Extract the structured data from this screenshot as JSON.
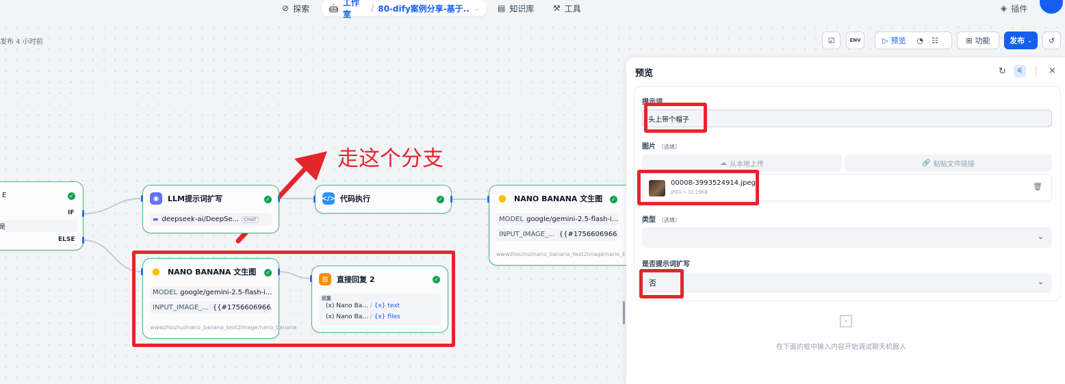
{
  "nav": {
    "explore": "探索",
    "studio": "工作室",
    "app_name": "80-dify案例分享-基于...",
    "knowledge": "知识库",
    "tools": "工具",
    "plugins": "插件"
  },
  "toolbar": {
    "publish_time": "发布 4 小时前",
    "preview": "预览",
    "features": "功能",
    "publish": "发布"
  },
  "annotation": {
    "text": "走这个分支"
  },
  "nodes": {
    "if_node": {
      "if_label": "IF",
      "else_label": "ELSE",
      "row_partial": "是",
      "title_partial": "E"
    },
    "llm": {
      "title": "LLM提示词扩写",
      "model": "deepseek-ai/DeepSe...",
      "mode": "CHAT"
    },
    "code": {
      "title": "代码执行"
    },
    "nano_top": {
      "title": "NANO BANANA 文生图",
      "model_label": "MODEL",
      "model_value": "google/gemini-2.5-flash-i...",
      "input_label": "INPUT_IMAGE_...",
      "input_value": "{{#1756606966...",
      "source": "wwwzhouhui/nano_banana_text2image/nano_b"
    },
    "nano_bottom": {
      "title": "NANO BANANA 文生图",
      "model_label": "MODEL",
      "model_value": "google/gemini-2.5-flash-i...",
      "input_label": "INPUT_IMAGE_...",
      "input_value": "{{#1756606966...",
      "source": "wwwzhouhui/nano_banana_text2image/nano_banana"
    },
    "reply": {
      "title": "直接回复 2",
      "section": "回复",
      "rows": [
        {
          "var": "Nano Ba...",
          "field": "text"
        },
        {
          "var": "Nano Ba...",
          "field": "files"
        }
      ]
    }
  },
  "preview": {
    "title": "预览",
    "prompt_label": "提示词",
    "prompt_value": "头上带个帽子",
    "image_label": "图片",
    "optional": "（选填）",
    "upload_local": "从本地上传",
    "paste_link": "粘贴文件链接",
    "file_name": "00008-3993524914.jpeg",
    "file_meta": "JPEG • 32.19KB",
    "type_label": "类型",
    "expand_label": "是否提示词扩写",
    "expand_value": "否",
    "empty_hint": "在下面的框中输入内容开始调试聊天机器人"
  },
  "colors": {
    "accent": "#155eef",
    "success": "#12a150",
    "annotation_red": "#e3262c"
  }
}
